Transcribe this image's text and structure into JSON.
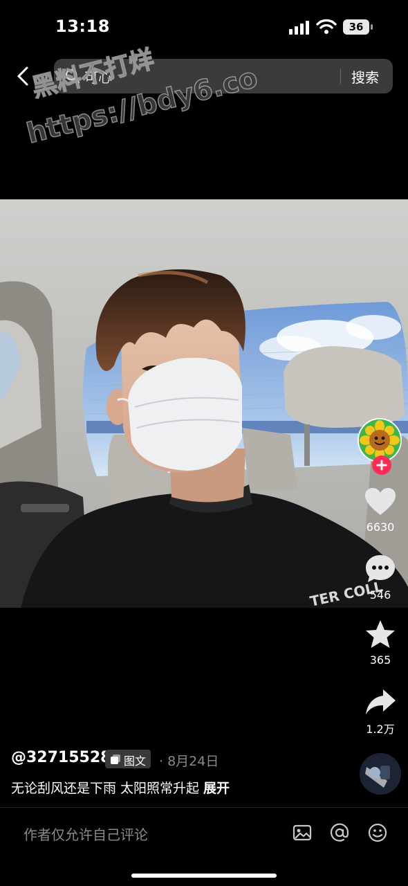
{
  "status_bar": {
    "time": "13:18",
    "battery": "36"
  },
  "header": {
    "search_query": "可心",
    "search_button": "搜索"
  },
  "watermark": {
    "line1": "黑料不打烊",
    "line2": "https://bdy6.co"
  },
  "actions": {
    "likes": "6630",
    "comments": "546",
    "favorites": "365",
    "shares": "1.2万"
  },
  "post": {
    "author": "@32715528",
    "type_badge": "图文",
    "date": "· 8月24日",
    "caption": "无论刮风还是下雨 太阳照常升起",
    "expand": "展开"
  },
  "comment_bar": {
    "placeholder": "作者仅允许自己评论"
  },
  "icons": [
    "back-arrow",
    "search",
    "signal",
    "wifi",
    "battery",
    "follow-plus",
    "heart",
    "comment",
    "star",
    "share",
    "image",
    "at",
    "emoji"
  ]
}
